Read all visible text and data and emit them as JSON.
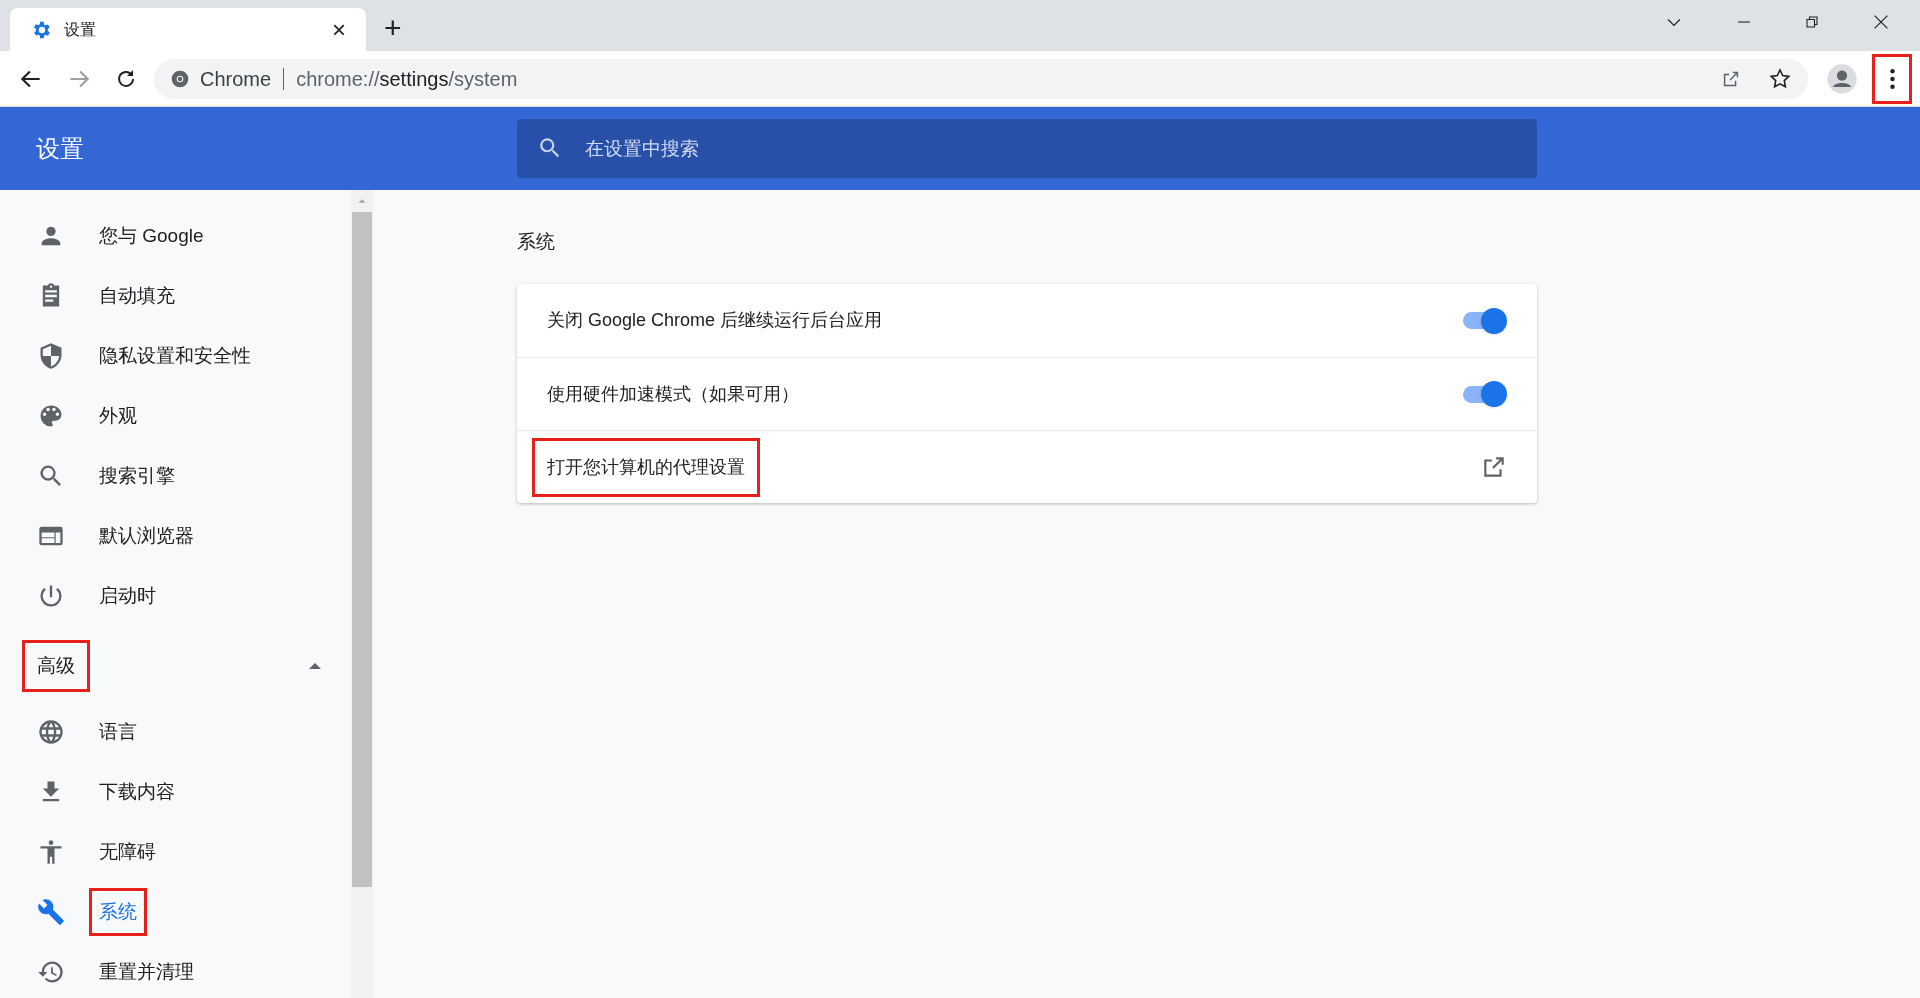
{
  "tab": {
    "title": "设置",
    "close": "×",
    "new_tab": "+"
  },
  "address_bar": {
    "site": "Chrome",
    "url_host": "chrome://",
    "url_bold": "settings",
    "url_path": "/system"
  },
  "menu_button": {
    "highlighted": true
  },
  "header": {
    "title": "设置",
    "search": {
      "placeholder": "在设置中搜索"
    }
  },
  "sidebar": {
    "items": [
      {
        "label": "您与 Google",
        "kind": "person",
        "selected": false,
        "highlighted": false
      },
      {
        "label": "自动填充",
        "kind": "clipboard",
        "selected": false,
        "highlighted": false
      },
      {
        "label": "隐私设置和安全性",
        "kind": "shield",
        "selected": false,
        "highlighted": false
      },
      {
        "label": "外观",
        "kind": "palette",
        "selected": false,
        "highlighted": false
      },
      {
        "label": "搜索引擎",
        "kind": "search",
        "selected": false,
        "highlighted": false
      },
      {
        "label": "默认浏览器",
        "kind": "browser",
        "selected": false,
        "highlighted": false
      },
      {
        "label": "启动时",
        "kind": "power",
        "selected": false,
        "highlighted": false
      }
    ],
    "advanced": {
      "label": "高级",
      "expanded": true,
      "highlighted": true
    },
    "advanced_items": [
      {
        "label": "语言",
        "kind": "globe",
        "selected": false,
        "highlighted": false
      },
      {
        "label": "下载内容",
        "kind": "download",
        "selected": false,
        "highlighted": false
      },
      {
        "label": "无障碍",
        "kind": "accessibility",
        "selected": false,
        "highlighted": false
      },
      {
        "label": "系统",
        "kind": "wrench",
        "selected": true,
        "highlighted": true
      },
      {
        "label": "重置并清理",
        "kind": "history",
        "selected": false,
        "highlighted": false
      }
    ]
  },
  "section": {
    "title": "系统",
    "rows": [
      {
        "kind": "toggle",
        "label": "关闭 Google Chrome 后继续运行后台应用",
        "on": true,
        "highlighted": false
      },
      {
        "kind": "toggle",
        "label": "使用硬件加速模式（如果可用）",
        "on": true,
        "highlighted": false
      },
      {
        "kind": "link",
        "label": "打开您计算机的代理设置",
        "highlighted": true
      }
    ]
  }
}
